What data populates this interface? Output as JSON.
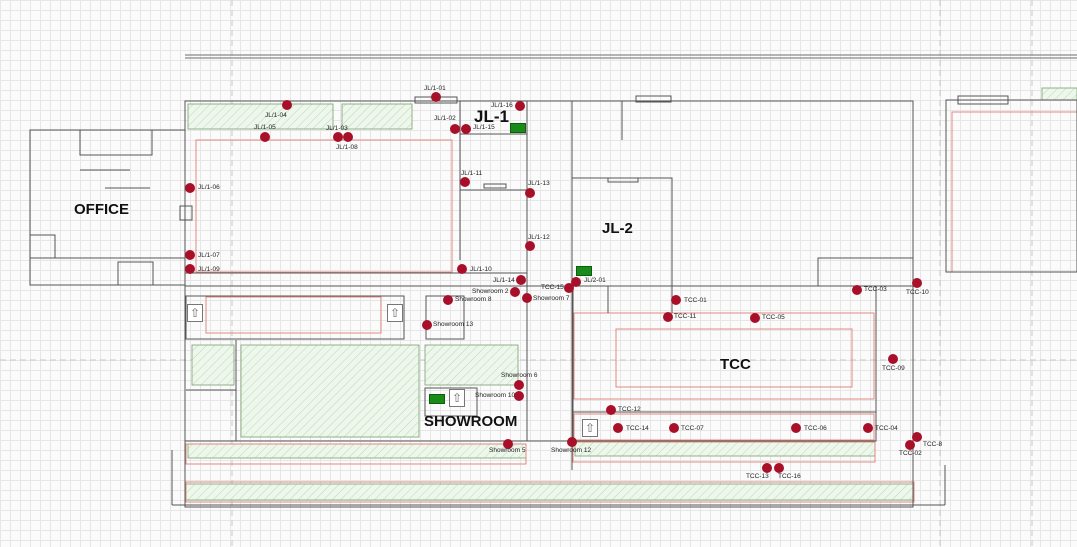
{
  "areas": {
    "office": "OFFICE",
    "jl1": "JL-1",
    "jl2": "JL-2",
    "tcc": "TCC",
    "showroom": "SHOWROOM"
  },
  "sensors": [
    {
      "id": "s-jl1-01",
      "label": "JL/1-01"
    },
    {
      "id": "s-jl1-04",
      "label": "JL/1-04"
    },
    {
      "id": "s-jl1-05",
      "label": "JL/1-05"
    },
    {
      "id": "s-jl1-03",
      "label": "JL/1-03"
    },
    {
      "id": "s-jl1-08",
      "label": "JL/1-08"
    },
    {
      "id": "s-jl1-02",
      "label": "JL/1-02"
    },
    {
      "id": "s-jl1-16",
      "label": "JL/1-16"
    },
    {
      "id": "s-jl1-15",
      "label": "JL/1-15"
    },
    {
      "id": "s-jl1-06",
      "label": "JL/1-06"
    },
    {
      "id": "s-jl1-11",
      "label": "JL/1-11"
    },
    {
      "id": "s-jl1-13",
      "label": "JL/1-13"
    },
    {
      "id": "s-jl1-12",
      "label": "JL/1-12"
    },
    {
      "id": "s-jl1-07",
      "label": "JL/1-07"
    },
    {
      "id": "s-jl1-09",
      "label": "JL/1-09"
    },
    {
      "id": "s-jl1-10",
      "label": "JL/1-10"
    },
    {
      "id": "s-jl1-14",
      "label": "JL/1-14"
    },
    {
      "id": "s-jl2-01",
      "label": "JL/2-01"
    },
    {
      "id": "s-tcc-15",
      "label": "TCC-15"
    },
    {
      "id": "s-sr-2",
      "label": "Showroom 2"
    },
    {
      "id": "s-sr-7",
      "label": "Showroom 7"
    },
    {
      "id": "s-sr-8",
      "label": "Showroom 8"
    },
    {
      "id": "s-sr-13",
      "label": "Showroom 13"
    },
    {
      "id": "s-sr-6",
      "label": "Showroom 6"
    },
    {
      "id": "s-sr-10",
      "label": "Showroom 10"
    },
    {
      "id": "s-sr-5",
      "label": "Showroom 5"
    },
    {
      "id": "s-sr-12",
      "label": "Showroom 12"
    },
    {
      "id": "s-tcc-01",
      "label": "TCC-01"
    },
    {
      "id": "s-tcc-11",
      "label": "TCC-11"
    },
    {
      "id": "s-tcc-05",
      "label": "TCC-05"
    },
    {
      "id": "s-tcc-03",
      "label": "TCC-03"
    },
    {
      "id": "s-tcc-10",
      "label": "TCC-10"
    },
    {
      "id": "s-tcc-09",
      "label": "TCC-09"
    },
    {
      "id": "s-tcc-12",
      "label": "TCC-12"
    },
    {
      "id": "s-tcc-14",
      "label": "TCC-14"
    },
    {
      "id": "s-tcc-07",
      "label": "TCC-07"
    },
    {
      "id": "s-tcc-06",
      "label": "TCC-06"
    },
    {
      "id": "s-tcc-04",
      "label": "TCC-04"
    },
    {
      "id": "s-tcc-8",
      "label": "TCC-8"
    },
    {
      "id": "s-tcc-02",
      "label": "TCC-02"
    },
    {
      "id": "s-tcc-13",
      "label": "TCC-13"
    },
    {
      "id": "s-tcc-16",
      "label": "TCC-16"
    }
  ],
  "colors": {
    "sensor": "#a8102a",
    "status_ok": "#1a8a1a",
    "wall": "#555555",
    "zone_outline": "#e08a80",
    "hatch": "#c5e0c0"
  }
}
